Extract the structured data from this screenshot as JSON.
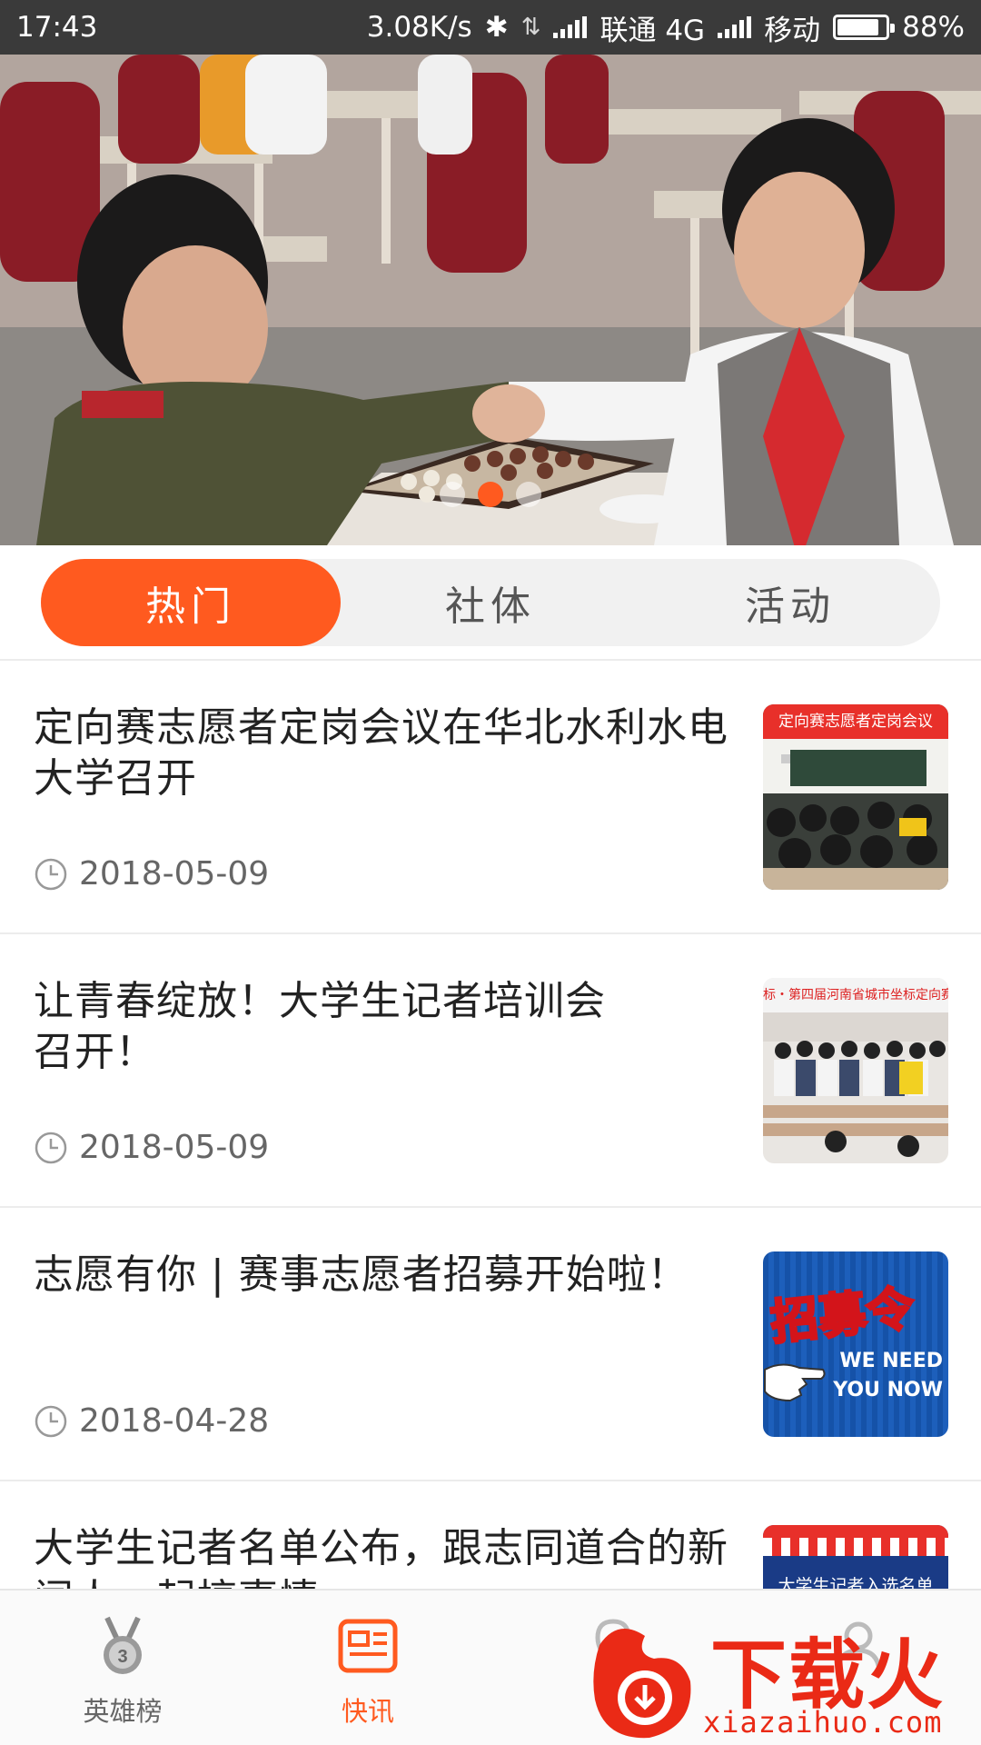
{
  "status_bar": {
    "time": "17:43",
    "net_speed": "3.08K/s",
    "carrier1": "联通 4G",
    "carrier2": "移动",
    "battery": "88%",
    "battery_level": 0.88
  },
  "banner": {
    "slide_count": 3,
    "active_index": 1,
    "accent": "#ff5a1f"
  },
  "tabs": [
    {
      "label": "热门",
      "active": true
    },
    {
      "label": "社体",
      "active": false
    },
    {
      "label": "活动",
      "active": false
    }
  ],
  "news": [
    {
      "title": "定向赛志愿者定岗会议在华北水利水电大学召开",
      "date": "2018-05-09",
      "thumb_caption": "定向赛志愿者定岗会议"
    },
    {
      "title": "让青春绽放！大学生记者培训会召开！",
      "date": "2018-05-09",
      "thumb_caption": "标・第四届河南省城市坐标定向赛大"
    },
    {
      "title": "志愿有你 | 赛事志愿者招募开始啦！",
      "date": "2018-04-28",
      "thumb_caption": "招募令",
      "thumb_en_1": "WE NEED",
      "thumb_en_2": "YOU NOW"
    },
    {
      "title": "大学生记者名单公布，跟志同道合的新闻人一起搞事情",
      "date": "",
      "thumb_caption": "大学生记者入选名单"
    }
  ],
  "bottom_nav": [
    {
      "label": "英雄榜",
      "icon": "medal-icon",
      "active": false,
      "medal_number": "3"
    },
    {
      "label": "快讯",
      "icon": "news-icon",
      "active": true
    },
    {
      "label": "",
      "icon": "map-icon",
      "active": false
    },
    {
      "label": "",
      "icon": "profile-icon",
      "active": false
    }
  ],
  "watermark": {
    "text": "下载火",
    "url": "xiazaihuo.com"
  }
}
